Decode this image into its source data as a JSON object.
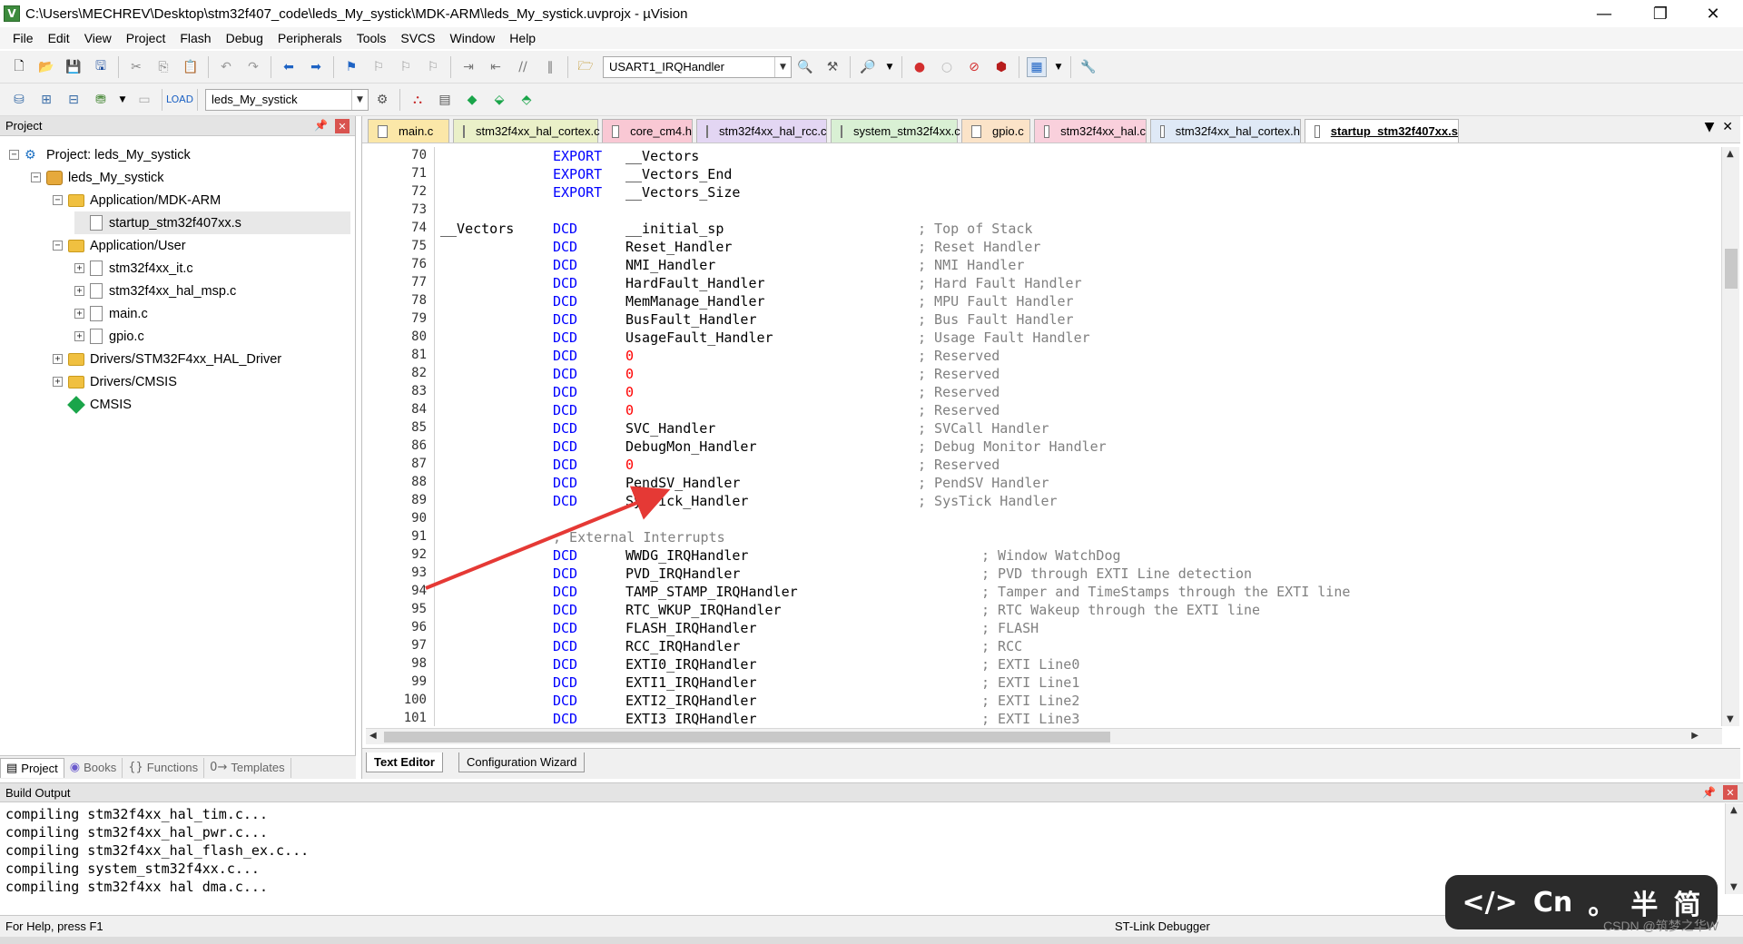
{
  "window": {
    "title": "C:\\Users\\MECHREV\\Desktop\\stm32f407_code\\leds_My_systick\\MDK-ARM\\leds_My_systick.uvprojx - µVision",
    "minimize_glyph": "—",
    "restore_glyph": "❐",
    "close_glyph": "✕"
  },
  "menu": [
    "File",
    "Edit",
    "View",
    "Project",
    "Flash",
    "Debug",
    "Peripherals",
    "Tools",
    "SVCS",
    "Window",
    "Help"
  ],
  "toolbar": {
    "function_combo": "USART1_IRQHandler",
    "target_combo": "leds_My_systick"
  },
  "project_panel": {
    "title": "Project",
    "tree": [
      {
        "label": "Project: leds_My_systick",
        "level": 0,
        "expander": "−",
        "icon": "project-icon"
      },
      {
        "label": "leds_My_systick",
        "level": 1,
        "expander": "−",
        "icon": "target-icon"
      },
      {
        "label": "Application/MDK-ARM",
        "level": 2,
        "expander": "−",
        "icon": "folder-icon"
      },
      {
        "label": "startup_stm32f407xx.s",
        "level": 3,
        "expander": "",
        "icon": "file-icon",
        "selected": true
      },
      {
        "label": "Application/User",
        "level": 2,
        "expander": "−",
        "icon": "folder-icon"
      },
      {
        "label": "stm32f4xx_it.c",
        "level": 3,
        "expander": "+",
        "icon": "file-icon"
      },
      {
        "label": "stm32f4xx_hal_msp.c",
        "level": 3,
        "expander": "+",
        "icon": "file-icon"
      },
      {
        "label": "main.c",
        "level": 3,
        "expander": "+",
        "icon": "file-icon"
      },
      {
        "label": "gpio.c",
        "level": 3,
        "expander": "+",
        "icon": "file-icon"
      },
      {
        "label": "Drivers/STM32F4xx_HAL_Driver",
        "level": 2,
        "expander": "+",
        "icon": "folder-icon"
      },
      {
        "label": "Drivers/CMSIS",
        "level": 2,
        "expander": "+",
        "icon": "folder-icon"
      },
      {
        "label": "CMSIS",
        "level": 2,
        "expander": "",
        "icon": "cmsis-gem-icon"
      }
    ],
    "bottom_tabs": [
      {
        "label": "Project",
        "icon": "▤",
        "active": true
      },
      {
        "label": "Books",
        "icon": "◉",
        "active": false
      },
      {
        "label": "Functions",
        "icon": "{}",
        "active": false
      },
      {
        "label": "Templates",
        "icon": "0→",
        "active": false
      }
    ]
  },
  "editor": {
    "tabs": [
      {
        "label": "main.c",
        "color": "#fbe7a8",
        "active": false
      },
      {
        "label": "stm32f4xx_hal_cortex.c",
        "color": "#eaf0c8",
        "active": false
      },
      {
        "label": "core_cm4.h",
        "color": "#f9c8d4",
        "active": false
      },
      {
        "label": "stm32f4xx_hal_rcc.c",
        "color": "#e3d6f3",
        "active": false
      },
      {
        "label": "system_stm32f4xx.c",
        "color": "#d9f0d4",
        "active": false
      },
      {
        "label": "gpio.c",
        "color": "#fbe3c8",
        "active": false
      },
      {
        "label": "stm32f4xx_hal.c",
        "color": "#f9d0dc",
        "active": false
      },
      {
        "label": "stm32f4xx_hal_cortex.h",
        "color": "#dfe9f6",
        "active": false
      },
      {
        "label": "startup_stm32f407xx.s",
        "color": "#ffffff",
        "active": true
      }
    ],
    "lines": [
      {
        "n": "70",
        "label": "",
        "op": "EXPORT",
        "arg": "__Vectors",
        "cmt": ""
      },
      {
        "n": "71",
        "label": "",
        "op": "EXPORT",
        "arg": "__Vectors_End",
        "cmt": ""
      },
      {
        "n": "72",
        "label": "",
        "op": "EXPORT",
        "arg": "__Vectors_Size",
        "cmt": ""
      },
      {
        "n": "73",
        "label": "",
        "op": "",
        "arg": "",
        "cmt": ""
      },
      {
        "n": "74",
        "label": "__Vectors",
        "op": "DCD",
        "arg": "__initial_sp",
        "cmt": "; Top of Stack"
      },
      {
        "n": "75",
        "label": "",
        "op": "DCD",
        "arg": "Reset_Handler",
        "cmt": "; Reset Handler"
      },
      {
        "n": "76",
        "label": "",
        "op": "DCD",
        "arg": "NMI_Handler",
        "cmt": "; NMI Handler"
      },
      {
        "n": "77",
        "label": "",
        "op": "DCD",
        "arg": "HardFault_Handler",
        "cmt": "; Hard Fault Handler"
      },
      {
        "n": "78",
        "label": "",
        "op": "DCD",
        "arg": "MemManage_Handler",
        "cmt": "; MPU Fault Handler"
      },
      {
        "n": "79",
        "label": "",
        "op": "DCD",
        "arg": "BusFault_Handler",
        "cmt": "; Bus Fault Handler"
      },
      {
        "n": "80",
        "label": "",
        "op": "DCD",
        "arg": "UsageFault_Handler",
        "cmt": "; Usage Fault Handler"
      },
      {
        "n": "81",
        "label": "",
        "op": "DCD",
        "arg": "0",
        "cmt": "; Reserved"
      },
      {
        "n": "82",
        "label": "",
        "op": "DCD",
        "arg": "0",
        "cmt": "; Reserved"
      },
      {
        "n": "83",
        "label": "",
        "op": "DCD",
        "arg": "0",
        "cmt": "; Reserved"
      },
      {
        "n": "84",
        "label": "",
        "op": "DCD",
        "arg": "0",
        "cmt": "; Reserved"
      },
      {
        "n": "85",
        "label": "",
        "op": "DCD",
        "arg": "SVC_Handler",
        "cmt": "; SVCall Handler"
      },
      {
        "n": "86",
        "label": "",
        "op": "DCD",
        "arg": "DebugMon_Handler",
        "cmt": "; Debug Monitor Handler"
      },
      {
        "n": "87",
        "label": "",
        "op": "DCD",
        "arg": "0",
        "cmt": "; Reserved"
      },
      {
        "n": "88",
        "label": "",
        "op": "DCD",
        "arg": "PendSV_Handler",
        "cmt": "; PendSV Handler"
      },
      {
        "n": "89",
        "label": "",
        "op": "DCD",
        "arg": "SysTick_Handler",
        "cmt": "; SysTick Handler"
      },
      {
        "n": "90",
        "label": "",
        "op": "",
        "arg": "",
        "cmt": ""
      },
      {
        "n": "91",
        "label": "",
        "op": "",
        "arg": "",
        "cmt": "; External Interrupts"
      },
      {
        "n": "92",
        "label": "",
        "op": "DCD",
        "arg": "WWDG_IRQHandler",
        "cmt": "; Window WatchDog"
      },
      {
        "n": "93",
        "label": "",
        "op": "DCD",
        "arg": "PVD_IRQHandler",
        "cmt": "; PVD through EXTI Line detection"
      },
      {
        "n": "94",
        "label": "",
        "op": "DCD",
        "arg": "TAMP_STAMP_IRQHandler",
        "cmt": "; Tamper and TimeStamps through the EXTI line"
      },
      {
        "n": "95",
        "label": "",
        "op": "DCD",
        "arg": "RTC_WKUP_IRQHandler",
        "cmt": "; RTC Wakeup through the EXTI line"
      },
      {
        "n": "96",
        "label": "",
        "op": "DCD",
        "arg": "FLASH_IRQHandler",
        "cmt": "; FLASH"
      },
      {
        "n": "97",
        "label": "",
        "op": "DCD",
        "arg": "RCC_IRQHandler",
        "cmt": "; RCC"
      },
      {
        "n": "98",
        "label": "",
        "op": "DCD",
        "arg": "EXTI0_IRQHandler",
        "cmt": "; EXTI Line0"
      },
      {
        "n": "99",
        "label": "",
        "op": "DCD",
        "arg": "EXTI1_IRQHandler",
        "cmt": "; EXTI Line1"
      },
      {
        "n": "100",
        "label": "",
        "op": "DCD",
        "arg": "EXTI2_IRQHandler",
        "cmt": "; EXTI Line2"
      },
      {
        "n": "101",
        "label": "",
        "op": "DCD",
        "arg": "EXTI3_IRQHandler",
        "cmt": "; EXTI Line3"
      }
    ],
    "bottom_tabs": [
      {
        "label": "Text Editor",
        "active": true
      },
      {
        "label": "Configuration Wizard",
        "active": false
      }
    ],
    "annotation_arrow_color": "#e53935"
  },
  "build_output": {
    "title": "Build Output",
    "lines": [
      "compiling stm32f4xx_hal_tim.c...",
      "compiling stm32f4xx_hal_pwr.c...",
      "compiling stm32f4xx_hal_flash_ex.c...",
      "compiling system_stm32f4xx.c...",
      "compiling stm32f4xx_hal_dma.c..."
    ]
  },
  "status": {
    "help": "For Help, press F1",
    "debugger": "ST-Link Debugger"
  },
  "ime": {
    "code_glyph": "</>",
    "lang": "Cn",
    "dot": "。",
    "half": "半",
    "simplified": "简"
  },
  "watermark": "CSDN @筑梦之华W",
  "colors": {
    "keyword": "#0000ff",
    "number": "#ff0000",
    "comment": "#808080"
  }
}
